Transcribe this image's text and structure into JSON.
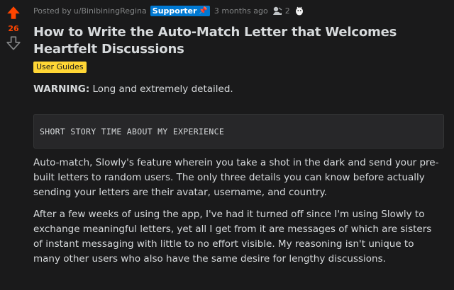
{
  "vote": {
    "score": "26",
    "upvote_color": "#ff4500"
  },
  "meta": {
    "posted_by_prefix": "Posted by",
    "author": "u/BinibiningRegina",
    "user_flair": "Supporter",
    "user_flair_icon": "pushpin-icon",
    "timestamp": "3 months ago",
    "award_count": "2",
    "award_icons": [
      "silver-award-icon",
      "wholesome-award-icon"
    ]
  },
  "post": {
    "title": "How to Write the Auto-Match Letter that Welcomes Heartfelt Discussions",
    "flair": "User Guides",
    "flair_color": "#ffd635",
    "warning_label": "WARNING:",
    "warning_text": " Long and extremely detailed.",
    "code_block": "SHORT STORY TIME ABOUT MY EXPERIENCE",
    "paragraphs": [
      "Auto-match, Slowly's feature wherein you take a shot in the dark and send your pre-built letters to random users. The only three details you can know before actually sending your letters are their avatar, username, and country.",
      "After a few weeks of using the app, I've had it turned off since I'm using Slowly to exchange meaningful letters, yet all I get from it are messages of which are sisters of instant messaging with little to no effort visible. My reasoning isn't unique to many other users who also have the same desire for lengthy discussions."
    ]
  },
  "colors": {
    "background": "#1a1a1b",
    "text": "#d7dadc",
    "meta_text": "#818384",
    "supporter_flair": "#0079d3"
  }
}
